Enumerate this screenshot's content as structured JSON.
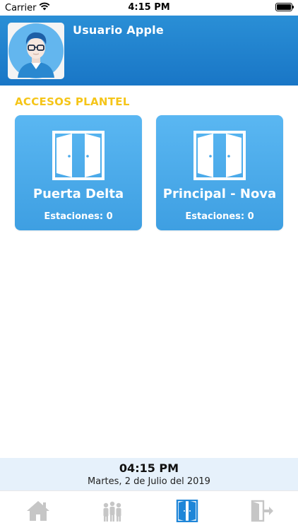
{
  "status_bar": {
    "carrier": "Carrier",
    "time": "4:15 PM"
  },
  "header": {
    "user_name": "Usuario Apple"
  },
  "section": {
    "title": "ACCESOS PLANTEL"
  },
  "access_cards": [
    {
      "title": "Puerta Delta",
      "stations": "Estaciones: 0"
    },
    {
      "title": "Principal - Nova",
      "stations": "Estaciones: 0"
    }
  ],
  "footer": {
    "time": "04:15 PM",
    "date": "Martes, 2 de Julio del 2019"
  },
  "tabs": [
    {
      "icon": "home-icon",
      "active": false
    },
    {
      "icon": "people-icon",
      "active": false
    },
    {
      "icon": "door-icon",
      "active": true
    },
    {
      "icon": "logout-icon",
      "active": false
    }
  ],
  "colors": {
    "header_blue": "#1976c6",
    "card_blue": "#4aa9ea",
    "section_yellow": "#f5c518",
    "footer_bg": "#e6f1fb",
    "tab_active": "#1f86d8",
    "tab_inactive": "#c6c6c6"
  }
}
